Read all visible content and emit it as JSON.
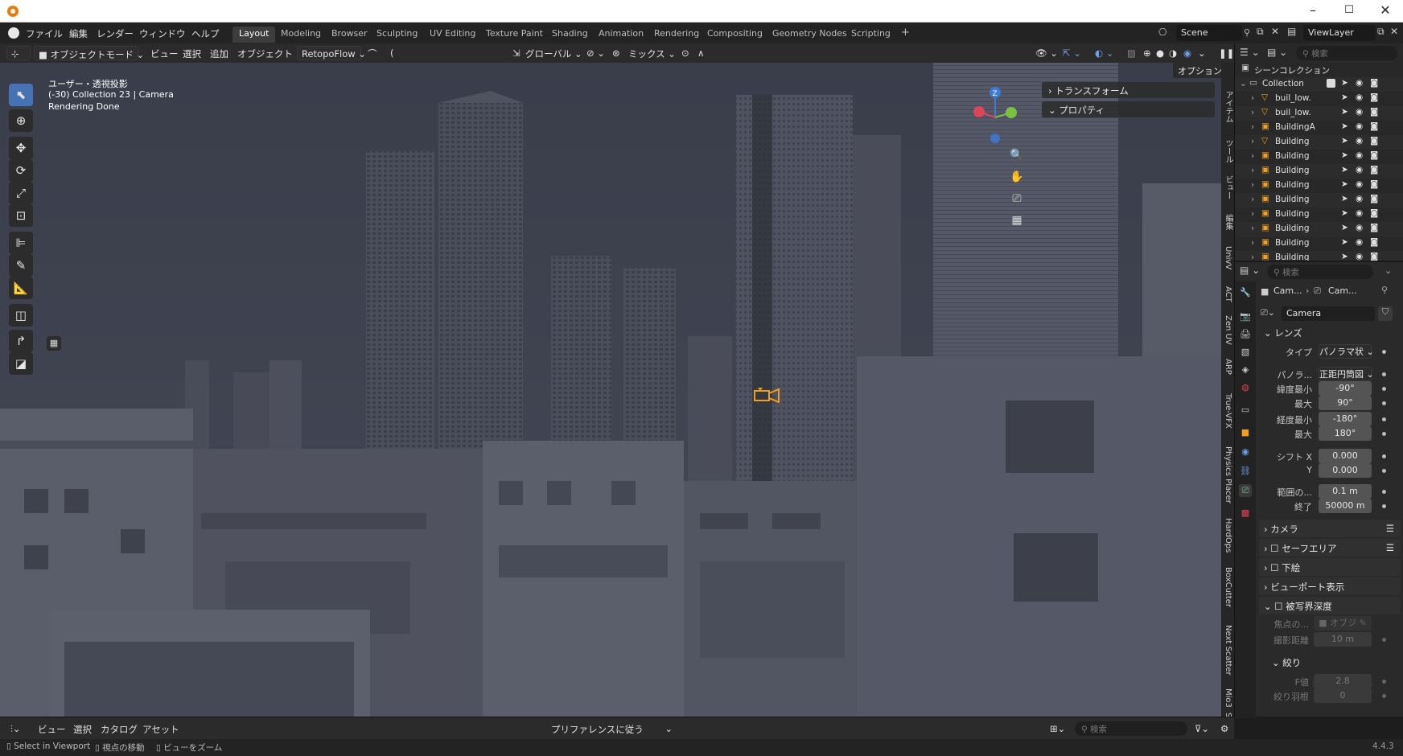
{
  "menu": {
    "file": "ファイル",
    "edit": "編集",
    "render": "レンダー",
    "window": "ウィンドウ",
    "help": "ヘルプ"
  },
  "workspaces": [
    "Layout",
    "Modeling",
    "Browser",
    "Sculpting",
    "UV Editing",
    "Texture Paint",
    "Shading",
    "Animation",
    "Rendering",
    "Compositing",
    "Geometry Nodes",
    "Scripting"
  ],
  "add_tab": "+",
  "scene": "Scene",
  "viewlayer": "ViewLayer",
  "header": {
    "mode": "オブジェクトモード",
    "view": "ビュー",
    "select": "選択",
    "add": "追加",
    "object": "オブジェクト",
    "addon": "RetopoFlow",
    "transform": "グローバル",
    "mix": "ミックス",
    "options": "オプション"
  },
  "viewport": {
    "line1": "ユーザー・透視投影",
    "line2": "(-30) Collection 23 | Camera",
    "line3": "Rendering Done",
    "panel_transform": "トランスフォーム",
    "panel_properties": "プロパティ",
    "gizmo_z": "Z"
  },
  "ntabs": [
    "アイテム",
    "ツール",
    "ビュー",
    "編集",
    "UnivV",
    "ACT",
    "Zen UV",
    "ARP",
    "True-VFX",
    "Physics Placer",
    "HardOps",
    "BoxCutter",
    "Next Scatter",
    "Mio3",
    "SEN"
  ],
  "outliner": {
    "search_placeholder": "検索",
    "root": "シーンコレクション",
    "collection": "Collection",
    "items": [
      "buil_low.",
      "buil_low.",
      "BuildingA",
      "Building",
      "Building",
      "Building",
      "Building",
      "Building",
      "Building",
      "Building",
      "Building",
      "Building"
    ]
  },
  "props": {
    "search_placeholder": "検索",
    "bc1": "Cam...",
    "bc2": "Cam...",
    "data_name": "Camera",
    "lens": "レンズ",
    "type_label": "タイプ",
    "type_value": "パノラマ状",
    "pano_label": "パノラ...",
    "pano_value": "正距円筒図",
    "lat_min_label": "緯度最小",
    "lat_min": "-90°",
    "lat_max_label": "最大",
    "lat_max": "90°",
    "lon_min_label": "経度最小",
    "lon_min": "-180°",
    "lon_max_label": "最大",
    "lon_max": "180°",
    "shift_x_label": "シフト X",
    "shift_x": "0.000",
    "shift_y_label": "Y",
    "shift_y": "0.000",
    "clip_start_label": "範囲の...",
    "clip_start": "0.1 m",
    "clip_end_label": "終了",
    "clip_end": "50000 m",
    "camera": "カメラ",
    "safe_areas": "セーフエリア",
    "background": "下絵",
    "viewport_display": "ビューポート表示",
    "dof": "被写界深度",
    "focus_obj_label": "焦点の...",
    "focus_obj": "オブジ",
    "focus_dist_label": "撮影距離",
    "focus_dist": "10 m",
    "aperture": "絞り",
    "fstop_label": "F値",
    "fstop": "2.8",
    "blades_label": "絞り羽根",
    "blades": "0"
  },
  "bottom": {
    "view": "ビュー",
    "select": "選択",
    "catalog": "カタログ",
    "asset": "アセット",
    "pref": "プリファレンスに従う",
    "search_placeholder": "検索"
  },
  "status": {
    "s1": "Select in Viewport",
    "s2": "視点の移動",
    "s3": "ビューをズーム",
    "version": "4.4.3"
  }
}
